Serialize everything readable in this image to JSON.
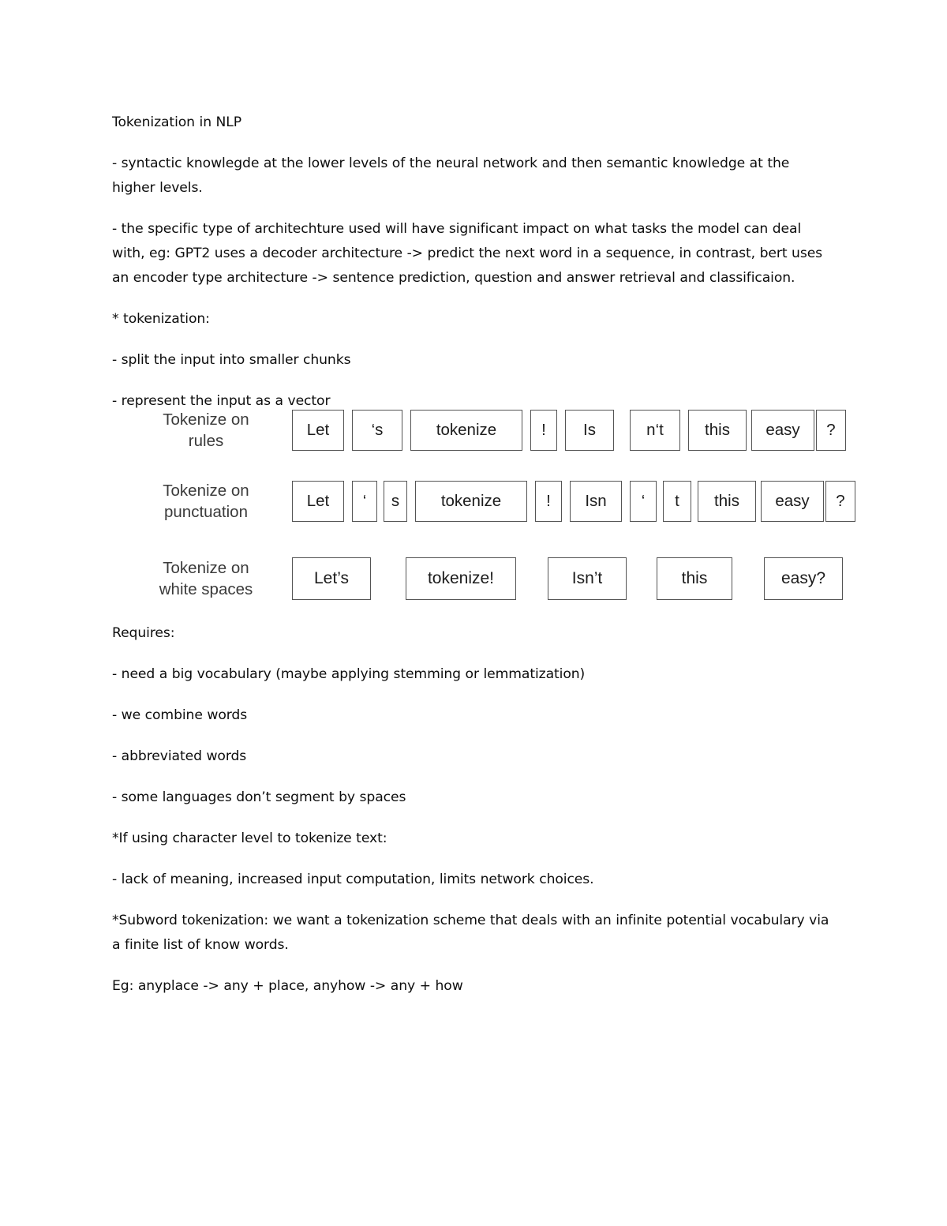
{
  "document": {
    "title": "Tokenization in NLP",
    "paragraphs": [
      "Tokenization in NLP",
      "- syntactic knowlegde at the lower levels of the neural network and then semantic knowledge at the higher levels.",
      "- the specific type of architechture used will have significant impact on what tasks the model can deal with, eg: GPT2 uses a decoder architecture -> predict the next word in a  sequence, in contrast, bert uses an encoder type architecture -> sentence prediction, question and answer retrieval and classificaion.",
      "* tokenization:",
      "- split the input into smaller chunks",
      "- represent the input as a vector"
    ],
    "paragraphs_after": [
      "Requires:",
      "- need a big vocabulary (maybe applying stemming or lemmatization)",
      "- we combine words",
      "- abbreviated words",
      "- some languages don’t segment by spaces",
      "*If using character level to tokenize text:",
      "- lack of meaning, increased input computation, limits network choices.",
      "*Subword tokenization: we want a tokenization scheme that deals with an infinite potential vocabulary via a finite list of know words.",
      "Eg: anyplace -> any + place, anyhow -> any + how"
    ]
  },
  "diagram": {
    "rows": [
      {
        "label_line1": "Tokenize on",
        "label_line2": "rules",
        "tokens": [
          "Let",
          "‘s",
          "tokenize",
          "!",
          "Is",
          "n‘t",
          "this",
          "easy",
          "?"
        ],
        "widths": [
          66,
          64,
          142,
          34,
          62,
          64,
          74,
          80,
          38
        ],
        "gaps": [
          10,
          10,
          10,
          10,
          20,
          10,
          6,
          2
        ]
      },
      {
        "label_line1": "Tokenize on",
        "label_line2": "punctuation",
        "tokens": [
          "Let",
          "‘",
          "s",
          "tokenize",
          "!",
          "Isn",
          "‘",
          "t",
          "this",
          "easy",
          "?"
        ],
        "widths": [
          66,
          32,
          30,
          142,
          34,
          66,
          34,
          36,
          74,
          80,
          38
        ],
        "gaps": [
          10,
          8,
          10,
          10,
          10,
          10,
          8,
          8,
          6,
          2
        ]
      },
      {
        "label_line1": "Tokenize on",
        "label_line2": "white spaces",
        "tokens": [
          "Let’s",
          "tokenize!",
          "Isn’t",
          "this",
          "easy?"
        ],
        "widths": [
          100,
          140,
          100,
          96,
          100
        ],
        "gaps": [
          44,
          40,
          38,
          40
        ]
      }
    ]
  },
  "colors": {
    "text": "#0d0d0d",
    "diagram_label": "#3b3b3b",
    "box_border": "#545454",
    "page_background": "#ffffff"
  }
}
